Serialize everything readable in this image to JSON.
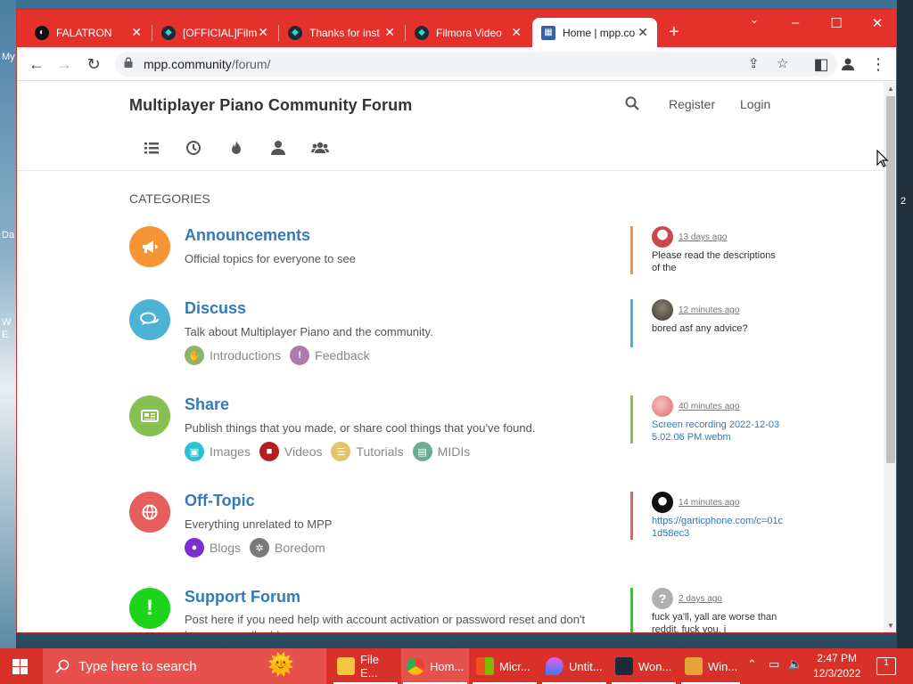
{
  "desktop": {
    "left_labels": [
      "My",
      "Da",
      "W",
      "E"
    ],
    "right_label": "2"
  },
  "browser": {
    "tabs": [
      {
        "label": "FALATRON",
        "icon": "falatron-icon",
        "fav_color": "#111111",
        "active": false
      },
      {
        "label": "[OFFICIAL]Film",
        "icon": "filmora-icon",
        "fav_color": "#1b2b3a",
        "active": false
      },
      {
        "label": "Thanks for inst",
        "icon": "filmora-icon",
        "fav_color": "#1b2b3a",
        "active": false
      },
      {
        "label": "Filmora Video",
        "icon": "filmora-icon",
        "fav_color": "#1b2b3a",
        "active": false
      },
      {
        "label": "Home | mpp.co",
        "icon": "mpp-icon",
        "fav_color": "#3a5fa8",
        "active": true
      }
    ],
    "new_tab_label": "+",
    "url_host": "mpp.community",
    "url_path": "/forum/"
  },
  "forum": {
    "site_title": "Multiplayer Piano Community Forum",
    "register_label": "Register",
    "login_label": "Login",
    "categories_heading": "CATEGORIES",
    "categories": [
      {
        "name": "Announcements",
        "description": "Official topics for everyone to see",
        "icon": "megaphone-icon",
        "color": "#f79433",
        "subcategories": [],
        "teaser": {
          "time": "13 days ago",
          "text": "Please read the descriptions of the",
          "link": false,
          "avatar_color": "#c94a4a",
          "border": "#f79433"
        }
      },
      {
        "name": "Discuss",
        "description": "Talk about Multiplayer Piano and the community.",
        "icon": "comments-icon",
        "color": "#4cb2d6",
        "subcategories": [
          {
            "label": "Introductions",
            "color": "#8fb36a",
            "icon": "hand-icon"
          },
          {
            "label": "Feedback",
            "color": "#b07aa8",
            "icon": "exclamation-icon"
          }
        ],
        "teaser": {
          "time": "12 minutes ago",
          "text": "bored asf any advice?",
          "link": false,
          "avatar_color": "#4a4a3a",
          "border": "#4cb2d6"
        }
      },
      {
        "name": "Share",
        "description": "Publish things that you made, or share cool things that you've found.",
        "icon": "newspaper-icon",
        "color": "#86c051",
        "subcategories": [
          {
            "label": "Images",
            "color": "#29c2d6",
            "icon": "image-icon"
          },
          {
            "label": "Videos",
            "color": "#b81d1d",
            "icon": "video-icon"
          },
          {
            "label": "Tutorials",
            "color": "#e6c26b",
            "icon": "list-icon"
          },
          {
            "label": "MIDIs",
            "color": "#6bab8f",
            "icon": "file-icon"
          }
        ],
        "teaser": {
          "time": "40 minutes ago",
          "text": "Screen recording 2022-12-03 5.02.06 PM.webm",
          "link": true,
          "avatar_color": "#e88a8a",
          "border": "#86c051"
        }
      },
      {
        "name": "Off-Topic",
        "description": "Everything unrelated to MPP",
        "icon": "globe-icon",
        "color": "#e85d5d",
        "subcategories": [
          {
            "label": "Blogs",
            "color": "#7b2fd1",
            "icon": "comment-icon"
          },
          {
            "label": "Boredom",
            "color": "#7a7a7a",
            "icon": "spinner-icon"
          }
        ],
        "teaser": {
          "time": "14 minutes ago",
          "text": "https://garticphone.com/c=01c1d58ec3",
          "link": true,
          "avatar_color": "#222222",
          "border": "#e85d5d"
        }
      },
      {
        "name": "Support Forum",
        "description": "Post here if you need help with account activation or password reset and don't have an email address.",
        "icon": "exclamation-icon",
        "color": "#1cd41c",
        "subcategories": [],
        "teaser": {
          "time": "2 days ago",
          "text": "fuck ya'll, yall are worse than reddit. fuck you, i",
          "link": false,
          "avatar_color": "#aaaaaa",
          "border": "#1cd41c"
        }
      }
    ]
  },
  "taskbar": {
    "search_placeholder": "Type here to search",
    "apps": [
      {
        "label": "File E...",
        "color": "#f5c542",
        "active": true
      },
      {
        "label": "Hom...",
        "color": "#4285f4",
        "active": true
      },
      {
        "label": "Micr...",
        "color": "#2f9be0",
        "active": true
      },
      {
        "label": "Untit...",
        "color": "#9b59d0",
        "active": true
      },
      {
        "label": "Won...",
        "color": "#1b2b3a",
        "active": true
      },
      {
        "label": "Win...",
        "color": "#e8a33a",
        "active": true
      }
    ],
    "time": "2:47 PM",
    "date": "12/3/2022",
    "notification_count": "1"
  }
}
